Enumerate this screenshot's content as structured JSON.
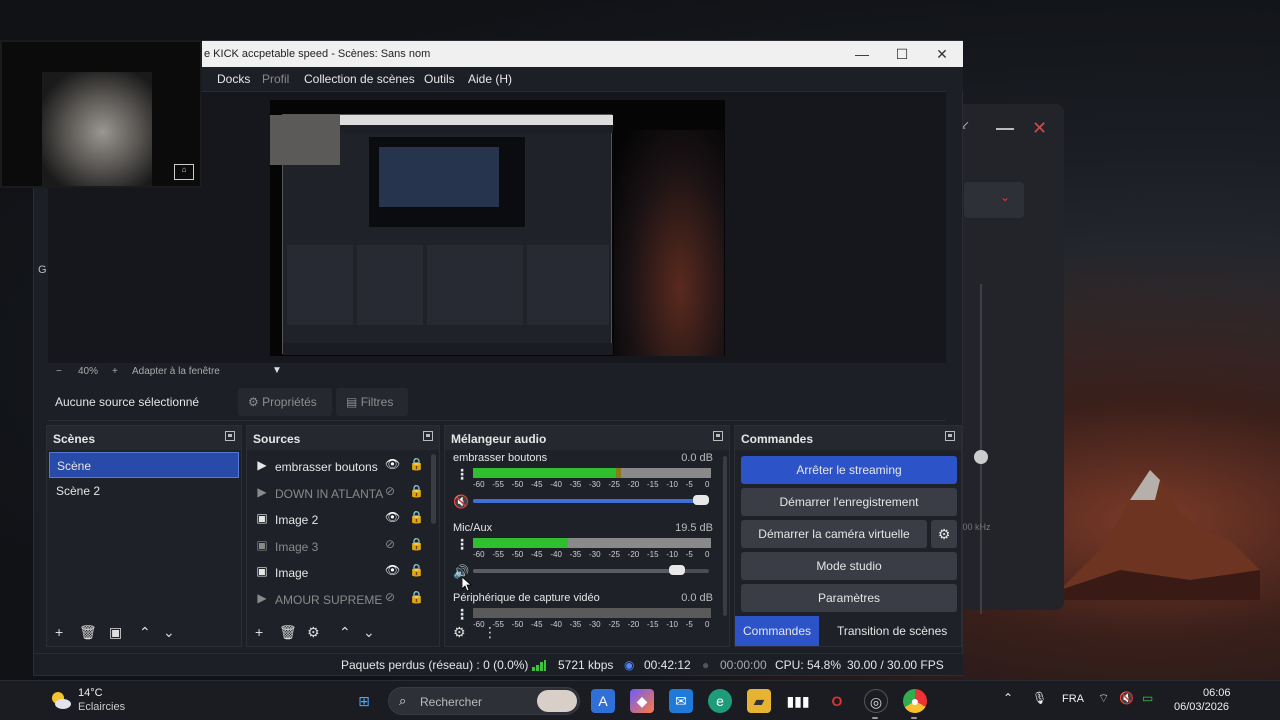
{
  "window": {
    "title": "e KICK accpetable speed - Scènes: Sans nom",
    "min_icon": "minimize-icon",
    "max_icon": "maximize-icon",
    "close_icon": "close-icon"
  },
  "menu": {
    "items": [
      "Docks",
      "Profil",
      "Collection de scènes",
      "Outils",
      "Aide (H)"
    ],
    "disabled": [
      "Profil"
    ]
  },
  "zoom": {
    "minus": "−",
    "value": "40%",
    "plus": "+",
    "fit": "Adapter à la fenêtre"
  },
  "source_toolbar": {
    "no_source": "Aucune source sélectionné",
    "properties": "Propriétés",
    "filters": "Filtres"
  },
  "scenes": {
    "title": "Scènes",
    "items": [
      {
        "label": "Scène",
        "selected": true
      },
      {
        "label": "Scène 2",
        "selected": false
      }
    ]
  },
  "sources": {
    "title": "Sources",
    "items": [
      {
        "label": "embrasser boutons",
        "type": "media-icon",
        "visible": true
      },
      {
        "label": "DOWN IN ATLANTA",
        "type": "media-icon",
        "visible": false
      },
      {
        "label": "Image 2",
        "type": "image-icon",
        "visible": true
      },
      {
        "label": "Image 3",
        "type": "image-icon",
        "visible": false
      },
      {
        "label": "Image",
        "type": "image-icon",
        "visible": true
      },
      {
        "label": "AMOUR SUPREME",
        "type": "media-icon",
        "visible": false
      }
    ]
  },
  "mixer": {
    "title": "Mélangeur audio",
    "scale": [
      "-60",
      "-55",
      "-50",
      "-45",
      "-40",
      "-35",
      "-30",
      "-25",
      "-20",
      "-15",
      "-10",
      "-5",
      "0"
    ],
    "channels": [
      {
        "name": "embrasser boutons",
        "db": "0.0 dB",
        "level": 0.62,
        "volume": 1.0,
        "muted": true
      },
      {
        "name": "Mic/Aux",
        "db": "19.5 dB",
        "level": 0.4,
        "volume": 0.9,
        "muted": false
      },
      {
        "name": "Périphérique de capture vidéo",
        "db": "0.0 dB",
        "level": 0.0,
        "volume": 1.0,
        "muted": false
      }
    ]
  },
  "controls": {
    "title": "Commandes",
    "stop_streaming": "Arrêter le streaming",
    "start_recording": "Démarrer l'enregistrement",
    "start_virtual_cam": "Démarrer la caméra virtuelle",
    "studio_mode": "Mode studio",
    "settings": "Paramètres",
    "tabs": [
      "Commandes",
      "Transition de scènes"
    ]
  },
  "status": {
    "dropped": "Paquets perdus (réseau) : 0 (0.0%)",
    "bitrate": "5721 kbps",
    "stream_time": "00:42:12",
    "rec_time": "00:00:00",
    "cpu": "CPU: 54.8%",
    "fps": "30.00 / 30.00 FPS"
  },
  "taskbar": {
    "temp": "14°C",
    "weather": "Eclaircies",
    "search_placeholder": "Rechercher",
    "lang": "FRA",
    "time": "06:06",
    "date": "06/03/2026"
  },
  "colors": {
    "accent": "#2c54c8",
    "meter_green": "#2fbf2f",
    "meter_yellow": "#8a7a1e",
    "meter_red": "#8e1a24"
  }
}
